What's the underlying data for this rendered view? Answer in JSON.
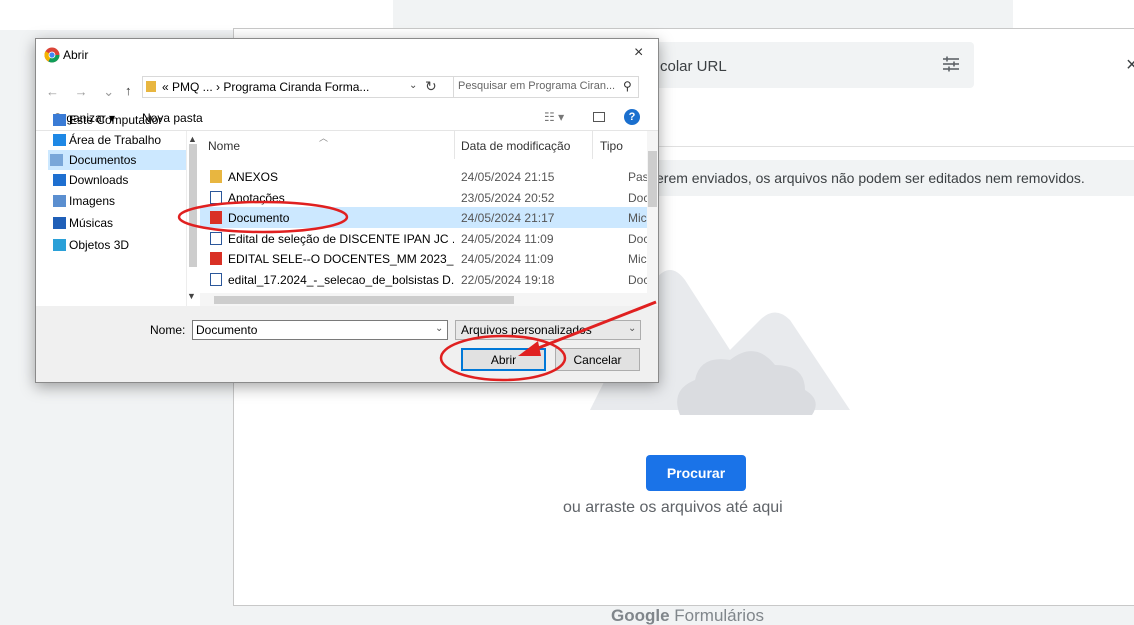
{
  "background": {
    "url_placeholder": "colar URL",
    "close_symbol": "×",
    "notice": "erem enviados, os arquivos não podem ser editados nem removidos.",
    "browse_button": "Procurar",
    "drag_text": "ou arraste os arquivos até aqui",
    "brand_google": "Google",
    "brand_product": " Formulários"
  },
  "dialog": {
    "title": "Abrir",
    "close_symbol": "×",
    "nav_arrows": "← → ⌄",
    "up_arrow": "↑",
    "address": "« PMQ ... › Programa Ciranda Forma...",
    "search_placeholder": "Pesquisar em Programa Ciran...",
    "toolbar": {
      "organize": "Organizar ▾",
      "new_folder": "Nova pasta",
      "help": "?"
    },
    "nav_items": [
      {
        "label": "Este Computador",
        "icon": "computer-icon",
        "selected": false
      },
      {
        "label": "Área de Trabalho",
        "icon": "desktop-icon",
        "selected": false
      },
      {
        "label": "Documentos",
        "icon": "documents-icon",
        "selected": true
      },
      {
        "label": "Downloads",
        "icon": "downloads-icon",
        "selected": false
      },
      {
        "label": "Imagens",
        "icon": "images-icon",
        "selected": false
      },
      {
        "label": "Músicas",
        "icon": "music-icon",
        "selected": false
      },
      {
        "label": "Objetos 3D",
        "icon": "objects-3d-icon",
        "selected": false
      }
    ],
    "columns": {
      "name": "Nome",
      "date": "Data de modificação",
      "type": "Tipo"
    },
    "files": [
      {
        "name": "ANEXOS",
        "date": "24/05/2024 21:15",
        "type": "Pasta de",
        "icon": "folder-icon",
        "selected": false
      },
      {
        "name": "Anotações",
        "date": "23/05/2024 20:52",
        "type": "Docume",
        "icon": "word-icon",
        "selected": false
      },
      {
        "name": "Documento",
        "date": "24/05/2024 21:17",
        "type": "Microso",
        "icon": "pdf-icon",
        "selected": true
      },
      {
        "name": "Edital de seleção de DISCENTE IPAN JC ...",
        "date": "24/05/2024 11:09",
        "type": "Docume",
        "icon": "word-icon",
        "selected": false
      },
      {
        "name": "EDITAL SELE--O DOCENTES_MM 2023_FI...",
        "date": "24/05/2024 11:09",
        "type": "Microso",
        "icon": "pdf-icon",
        "selected": false
      },
      {
        "name": "edital_17.2024_-_selecao_de_bolsistas D...",
        "date": "22/05/2024 19:18",
        "type": "Docume",
        "icon": "word-icon",
        "selected": false
      }
    ],
    "filename_label": "Nome:",
    "filename_value": "Documento",
    "filter_value": "Arquivos personalizados",
    "open_button": "Abrir",
    "cancel_button": "Cancelar"
  },
  "colors": {
    "accent": "#1a73e8",
    "selection": "#cce8ff",
    "annotation": "#e02020"
  }
}
